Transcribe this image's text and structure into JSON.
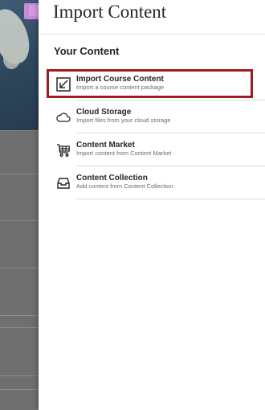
{
  "panel": {
    "title": "Import Content",
    "section_heading": "Your Content"
  },
  "items": [
    {
      "title": "Import Course Content",
      "subtitle": "Import a course content package",
      "icon": "import-arrow-icon"
    },
    {
      "title": "Cloud Storage",
      "subtitle": "Import files from your cloud storage",
      "icon": "cloud-icon"
    },
    {
      "title": "Content Market",
      "subtitle": "Import content from Content Market",
      "icon": "cart-icon"
    },
    {
      "title": "Content Collection",
      "subtitle": "Add content from Content Collection",
      "icon": "inbox-icon"
    }
  ],
  "colors": {
    "highlight": "#a01c22",
    "accent_tab": "#c68ad6"
  }
}
